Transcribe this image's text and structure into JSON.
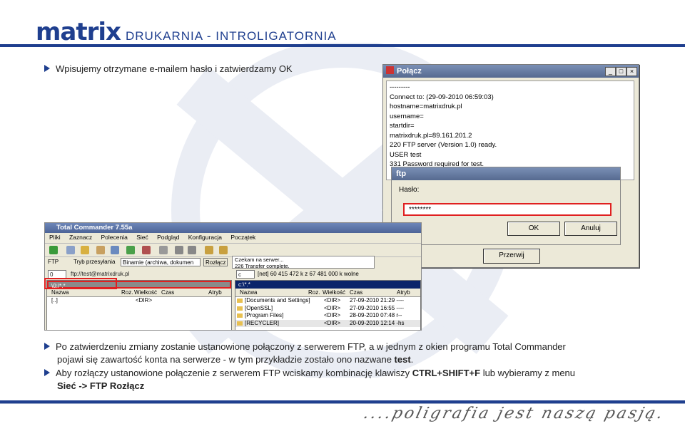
{
  "header": {
    "logo": "matrix",
    "tagline": "DRUKARNIA - INTROLIGATORNIA"
  },
  "bullets": {
    "b1": "Wpisujemy otrzymane e-mailem hasło i zatwierdzamy OK",
    "b2_line1": "Po zatwierdzeniu zmiany zostanie ustanowione połączony z serwerem FTP, a w jednym z okien programu Total Commander",
    "b2_line2_pre": "pojawi się zawartość konta na serwerze - w tym przykładzie zostało ono nazwane ",
    "b2_line2_bold": "test",
    "b2_line2_post": ".",
    "b3_pre": "Aby rozłączy ustanowione połączenie z serwerem FTP wciskamy kombinację klawiszy ",
    "b3_bold": "CTRL+SHIFT+F",
    "b3_mid": " lub wybieramy z menu",
    "b3_line2": "Sieć -> FTP Rozłącz"
  },
  "connect_dialog": {
    "title": "Połącz",
    "log": [
      "---------",
      "Connect to: (29-09-2010 06:59:03)",
      "hostname=matrixdruk.pl",
      "username=",
      "startdir=",
      "matrixdruk.pl=89.161.201.2",
      "220 FTP server (Version 1.0) ready.",
      "USER test",
      "331 Password required for test."
    ],
    "disconnect_button": "Przerwij"
  },
  "ftp_dialog": {
    "title": "ftp",
    "password_label": "Hasło:",
    "password_value": "********",
    "ok_button": "OK",
    "cancel_button": "Anuluj"
  },
  "total_commander": {
    "title": "Total Commander 7.55a",
    "menu": [
      "Pliki",
      "Zaznacz",
      "Polecenia",
      "Sieć",
      "Podgląd",
      "Konfiguracja",
      "Początek"
    ],
    "ftp_label": "FTP",
    "transfer_mode_label": "Tryb przesyłania",
    "transfer_mode_value": "Binarnie (archiwa, dokumen",
    "disconnect_label": "Rozłącz",
    "status_lines": [
      "Czekam na serwer...",
      "226 Transfer complete."
    ],
    "left": {
      "drive": "0",
      "path_combo": "ftp://test@matrixdruk.pl",
      "path": "\\0:/*.*",
      "headers": [
        "Nazwa",
        "Roz.",
        "Wielkość",
        "Czas",
        "Atryb"
      ],
      "rows": [
        {
          "name": "[..]",
          "ext": "",
          "size": "<DIR>",
          "date": ""
        }
      ]
    },
    "right": {
      "drive": "c",
      "volume": "[net]  60 415 472 k z 67 481 000 k wolne",
      "path": "c:\\*.*",
      "headers": [
        "Nazwa",
        "Roz.",
        "Wielkość",
        "Czas",
        "Atryb"
      ],
      "rows": [
        {
          "name": "[Documents and Settings]",
          "size": "<DIR>",
          "date": "27-09-2010 21:29 ----"
        },
        {
          "name": "[OpenSSL]",
          "size": "<DIR>",
          "date": "27-09-2010 16:55 ----"
        },
        {
          "name": "[Program Files]",
          "size": "<DIR>",
          "date": "28-09-2010 07:48 r--"
        },
        {
          "name": "[RECYCLER]",
          "size": "<DIR>",
          "date": "20-09-2010 12:14 -hs"
        }
      ]
    }
  },
  "footer": {
    "slogan": "....poligrafia jest naszą pasją."
  },
  "colors": {
    "brand": "#1f3f8f",
    "highlight": "#e02020"
  }
}
